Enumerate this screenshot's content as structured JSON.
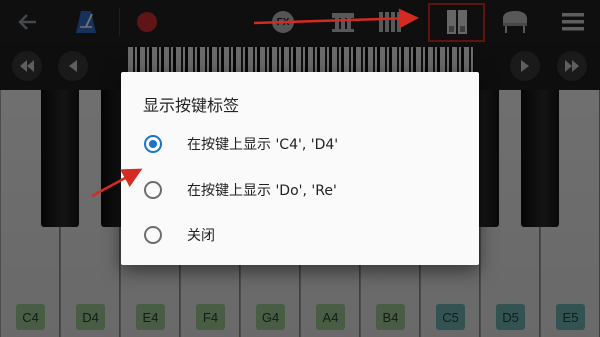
{
  "toolbar": {
    "items": [
      {
        "icon": "back-arrow-icon"
      },
      {
        "icon": "metronome-icon"
      },
      {
        "icon": "record-icon"
      },
      {
        "icon": "fx-icon",
        "label": "FX"
      },
      {
        "icon": "piano-mode-icon"
      },
      {
        "icon": "keyboard-layout-icon"
      },
      {
        "icon": "split-keyboard-icon"
      },
      {
        "icon": "grand-piano-icon"
      },
      {
        "icon": "menu-icon"
      }
    ]
  },
  "scroll": {
    "left_buttons": [
      "fast-rewind-icon",
      "prev-icon"
    ],
    "right_buttons": [
      "next-icon",
      "fast-forward-icon"
    ]
  },
  "keyboard": {
    "white_keys": [
      "C4",
      "D4",
      "E4",
      "F4",
      "G4",
      "A4",
      "B4",
      "C5",
      "D5",
      "E5"
    ]
  },
  "dialog": {
    "title": "显示按键标签",
    "options": [
      {
        "label": "在按键上显示 'C4', 'D4'",
        "selected": true
      },
      {
        "label": "在按键上显示 'Do', 'Re'",
        "selected": false
      },
      {
        "label": "关闭",
        "selected": false
      }
    ]
  },
  "colors": {
    "accent": "#1a73c8",
    "record": "#d32f2f",
    "annotation": "#d32a22",
    "label_green": "#a3cf9a",
    "label_teal": "#6fb8b3"
  }
}
